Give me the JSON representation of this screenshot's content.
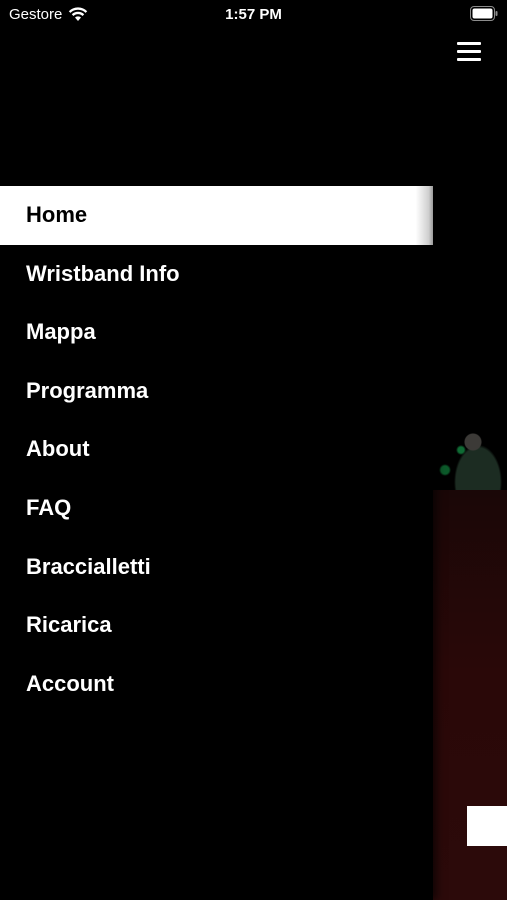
{
  "status_bar": {
    "carrier": "Gestore",
    "time": "1:57 PM",
    "wifi_icon": "wifi-icon",
    "battery_icon": "battery-icon"
  },
  "header": {
    "menu_icon": "hamburger-menu-icon"
  },
  "drawer": {
    "active_index": 0,
    "items": [
      {
        "label": "Home"
      },
      {
        "label": "Wristband Info"
      },
      {
        "label": "Mappa"
      },
      {
        "label": "Programma"
      },
      {
        "label": "About"
      },
      {
        "label": "FAQ"
      },
      {
        "label": "Braccialletti"
      },
      {
        "label": "Ricarica"
      },
      {
        "label": "Account"
      }
    ]
  },
  "colors": {
    "background": "#000000",
    "menu_text": "#ffffff",
    "active_bg": "#ffffff",
    "active_text": "#000000"
  }
}
